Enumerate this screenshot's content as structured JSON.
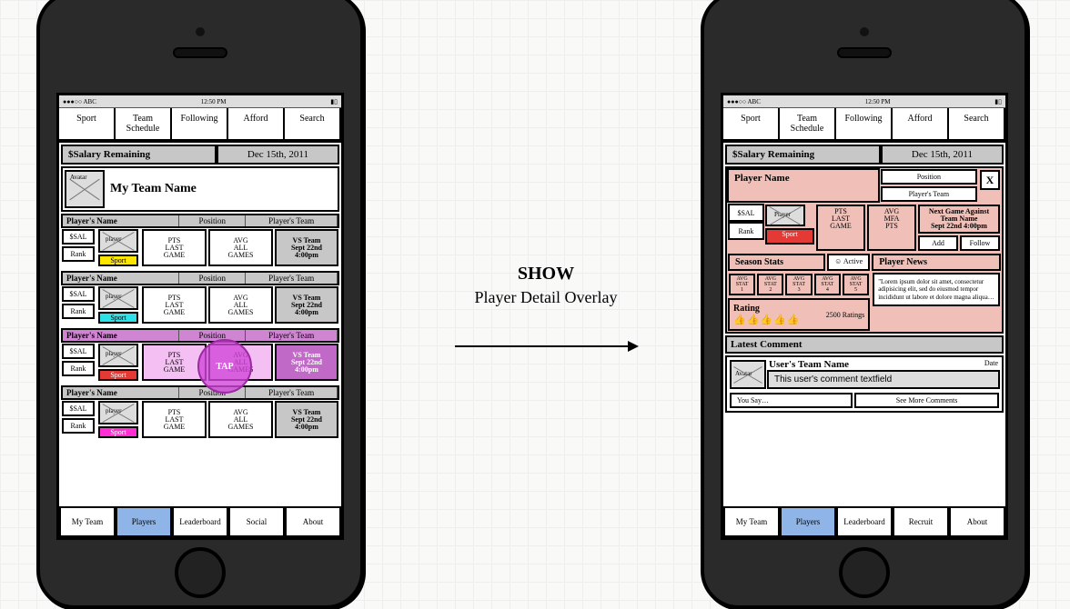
{
  "statusbar": {
    "carrier": "●●●○○ ABC",
    "time": "12:50 PM",
    "battery": "▮▯"
  },
  "topnav": [
    "Sport",
    "Team Schedule",
    "Following",
    "Afford",
    "Search"
  ],
  "salaryLabel": "$Salary Remaining",
  "dateLabel": "Dec 15th, 2011",
  "teamAvatar": "Avatar",
  "teamName": "My Team Name",
  "playerRowHeaders": {
    "name": "Player's Name",
    "pos": "Position",
    "team": "Player's Team"
  },
  "playerRowCells": {
    "sal": "$SAL",
    "player": "player",
    "rank": "Rank",
    "sport": "Sport",
    "pts": "PTS\nLAST\nGAME",
    "avg": "AVG\nALL\nGAMES",
    "vs": "VS Team\nSept 22nd\n4:00pm"
  },
  "sportColors": [
    "sp-yellow",
    "sp-cyan",
    "sp-red",
    "sp-mag"
  ],
  "tapLabel": "TAP",
  "bottomnavLeft": [
    "My Team",
    "Players",
    "Leaderboard",
    "Social",
    "About"
  ],
  "bottomnavRight": [
    "My Team",
    "Players",
    "Leaderboard",
    "Recruit",
    "About"
  ],
  "annoTitle": "SHOW",
  "annoSub": "Player Detail Overlay",
  "overlay": {
    "name": "Player Name",
    "position": "Position",
    "team": "Player's Team",
    "close": "X",
    "sal": "$SAL",
    "rank": "Rank",
    "player": "Player",
    "sport": "Sport",
    "pts": "PTS\nLAST\nGAME",
    "avgmfa": "AVG\nMFA\nPTS",
    "next": "Next Game Against\nTeam Name\nSept 22nd 4:00pm",
    "add": "Add",
    "follow": "Follow",
    "seasonStats": "Season Stats",
    "active": "☺ Active",
    "statPills": [
      "AVG STAT 1",
      "AVG STAT 2",
      "AVG STAT 3",
      "AVG STAT 4",
      "AVG STAT 5"
    ],
    "rating": "Rating",
    "ratingCount": "2500 Ratings",
    "newsTitle": "Player News",
    "newsBody": "\"Lorem ipsum dolor sit amet, consectetur adipisicing elit, sed do eiusmod tempor incididunt ut labore et dolore magna aliqua…",
    "latestComment": "Latest Comment",
    "commentAvatar": "Avatar",
    "commenterTeam": "User's Team Name",
    "commentDate": "Date",
    "commentText": "This user's comment textfield",
    "youSay": "You Say…",
    "seeMore": "See More Comments"
  }
}
